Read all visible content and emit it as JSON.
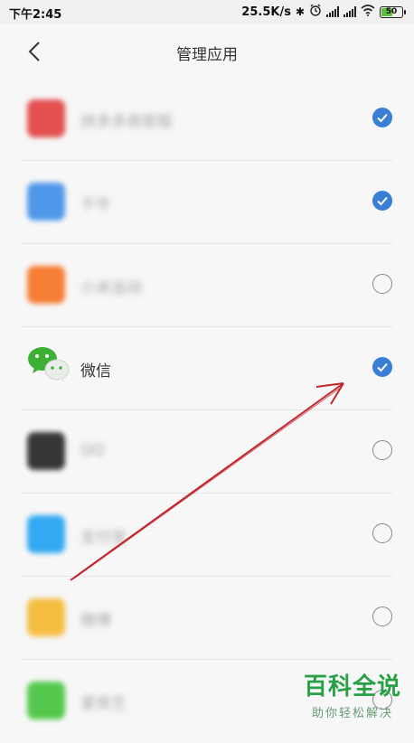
{
  "status_bar": {
    "time": "下午2:45",
    "net_speed": "25.5K/s",
    "battery": "50"
  },
  "header": {
    "title": "管理应用"
  },
  "apps": [
    {
      "name": "拼多多商家版",
      "checked": true,
      "blurred": true,
      "icon": "pinduoduo-icon",
      "color": "#e23d3d"
    },
    {
      "name": "千牛",
      "checked": true,
      "blurred": true,
      "icon": "qianniu-icon",
      "color": "#3d8ee8"
    },
    {
      "name": "小米运动",
      "checked": false,
      "blurred": true,
      "icon": "mi-fit-icon",
      "color": "#f5701f"
    },
    {
      "name": "微信",
      "checked": true,
      "blurred": false,
      "icon": "wechat-icon",
      "color": "#3cb034"
    },
    {
      "name": "QQ",
      "checked": false,
      "blurred": true,
      "icon": "qq-icon",
      "color": "#222222"
    },
    {
      "name": "支付宝",
      "checked": false,
      "blurred": true,
      "icon": "alipay-icon",
      "color": "#1da1f2"
    },
    {
      "name": "微博",
      "checked": false,
      "blurred": true,
      "icon": "weibo-icon",
      "color": "#f5b82e"
    },
    {
      "name": "爱奇艺",
      "checked": false,
      "blurred": true,
      "icon": "iqiyi-icon",
      "color": "#43c43a"
    }
  ],
  "watermark": {
    "main": "百科全说",
    "sub": "助你轻松解决"
  },
  "colors": {
    "accent": "#3a7fd5",
    "annotation_arrow": "#c0272d"
  }
}
